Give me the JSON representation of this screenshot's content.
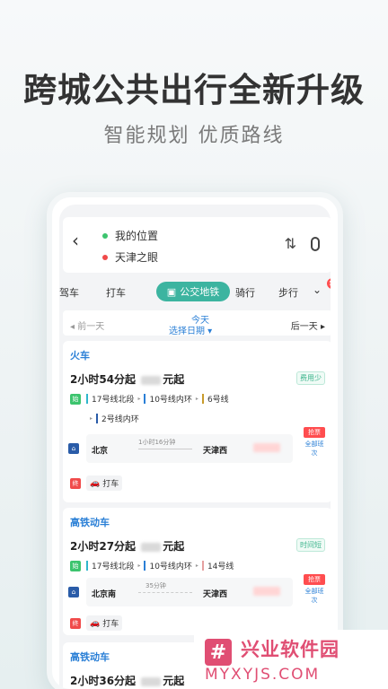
{
  "headline": "跨城公共出行全新升级",
  "subline": "智能规划  优质路线",
  "search": {
    "origin": "我的位置",
    "destination": "天津之眼",
    "back_icon": "back-arrow-icon",
    "swap_icon": "swap-icon",
    "mic_icon": "microphone-icon"
  },
  "modes": {
    "items": [
      "驾车",
      "打车",
      "公交地铁",
      "骑行",
      "步行"
    ],
    "active": "公交地铁",
    "new_badge": "新"
  },
  "datebar": {
    "prev": "前一天",
    "today": "今天",
    "choose": "选择日期",
    "next": "后一天"
  },
  "results": [
    {
      "category": "火车",
      "duration": "2小时54分起",
      "price_suffix": "元起",
      "tag": "费用少",
      "lines": [
        "17号线北段",
        "10号线内环",
        "6号线",
        "2号线内环"
      ],
      "start_marker": "始",
      "end_marker": "终",
      "train_from": "北京",
      "train_time": "1小时16分钟",
      "train_to": "天津西",
      "ticket_buy": "抢票",
      "ticket_all": "全部班次",
      "taxi": "打车"
    },
    {
      "category": "高铁动车",
      "duration": "2小时27分起",
      "price_suffix": "元起",
      "tag": "时间短",
      "lines": [
        "17号线北段",
        "10号线内环",
        "14号线"
      ],
      "start_marker": "始",
      "end_marker": "终",
      "train_from": "北京南",
      "train_time": "35分钟",
      "train_to": "天津西",
      "ticket_buy": "抢票",
      "ticket_all": "全部班次",
      "taxi": "打车"
    },
    {
      "category": "高铁动车",
      "duration": "2小时36分起",
      "price_suffix": "元起"
    }
  ],
  "watermark": {
    "title": "兴业软件园",
    "url": "MYXYJS.COM",
    "logo_glyph": "#"
  },
  "colors": {
    "accent": "#3cb4a0",
    "category": "#2a7fd6",
    "watermark": "#e04e73"
  }
}
